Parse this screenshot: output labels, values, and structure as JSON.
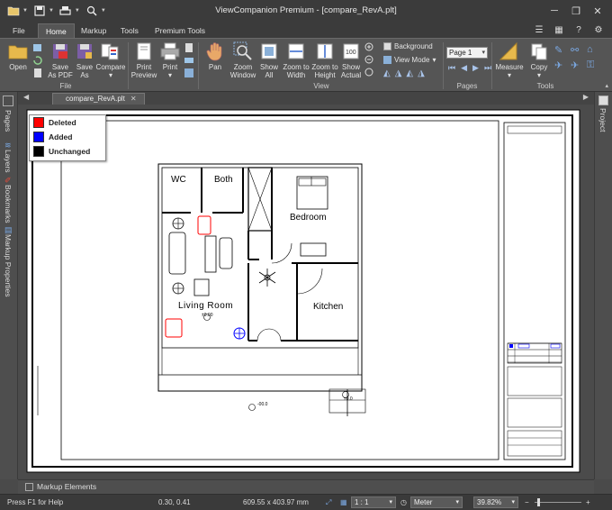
{
  "window": {
    "title": "ViewCompanion Premium - [compare_RevA.plt]"
  },
  "tabs": [
    "File",
    "Home",
    "Markup",
    "Tools",
    "Premium Tools"
  ],
  "active_tab": "Home",
  "ribbon": {
    "file_group": {
      "label": "File",
      "buttons": [
        "Open",
        "Save\nAs PDF",
        "Save\nAs",
        "Compare"
      ]
    },
    "print_buttons": [
      "Print\nPreview",
      "Print"
    ],
    "view_group": {
      "label": "View",
      "buttons": [
        "Pan",
        "Zoom\nWindow",
        "Show\nAll",
        "Zoom to\nWidth",
        "Zoom to\nHeight",
        "Show\nActual"
      ],
      "background_label": "Background",
      "view_mode_label": "View Mode"
    },
    "pages_group": {
      "label": "Pages",
      "page_select": "Page 1"
    },
    "tools_group": {
      "label": "Tools",
      "buttons": [
        "Measure",
        "Copy"
      ]
    }
  },
  "side_panels": {
    "left": [
      "Pages",
      "Layers",
      "Bookmarks",
      "Markup Properties"
    ],
    "right": [
      "Project"
    ]
  },
  "document_tab": "compare_RevA.plt",
  "legend": [
    {
      "label": "Deleted",
      "color": "#ff0000"
    },
    {
      "label": "Added",
      "color": "#0000ff"
    },
    {
      "label": "Unchanged",
      "color": "#000000"
    }
  ],
  "drawing": {
    "rooms": [
      "WC",
      "Both",
      "Bedroom",
      "Living Room",
      "Kitchen"
    ],
    "level_marks": [
      "±0.00",
      "-00.0",
      "±0.0"
    ]
  },
  "markup_panel_label": "Markup Elements",
  "status": {
    "help": "Press F1 for Help",
    "coords": "0.30, 0.41",
    "dimensions": "609.55 x 403.97 mm",
    "scale": "1 : 1",
    "unit": "Meter",
    "zoom": "39.82%"
  }
}
